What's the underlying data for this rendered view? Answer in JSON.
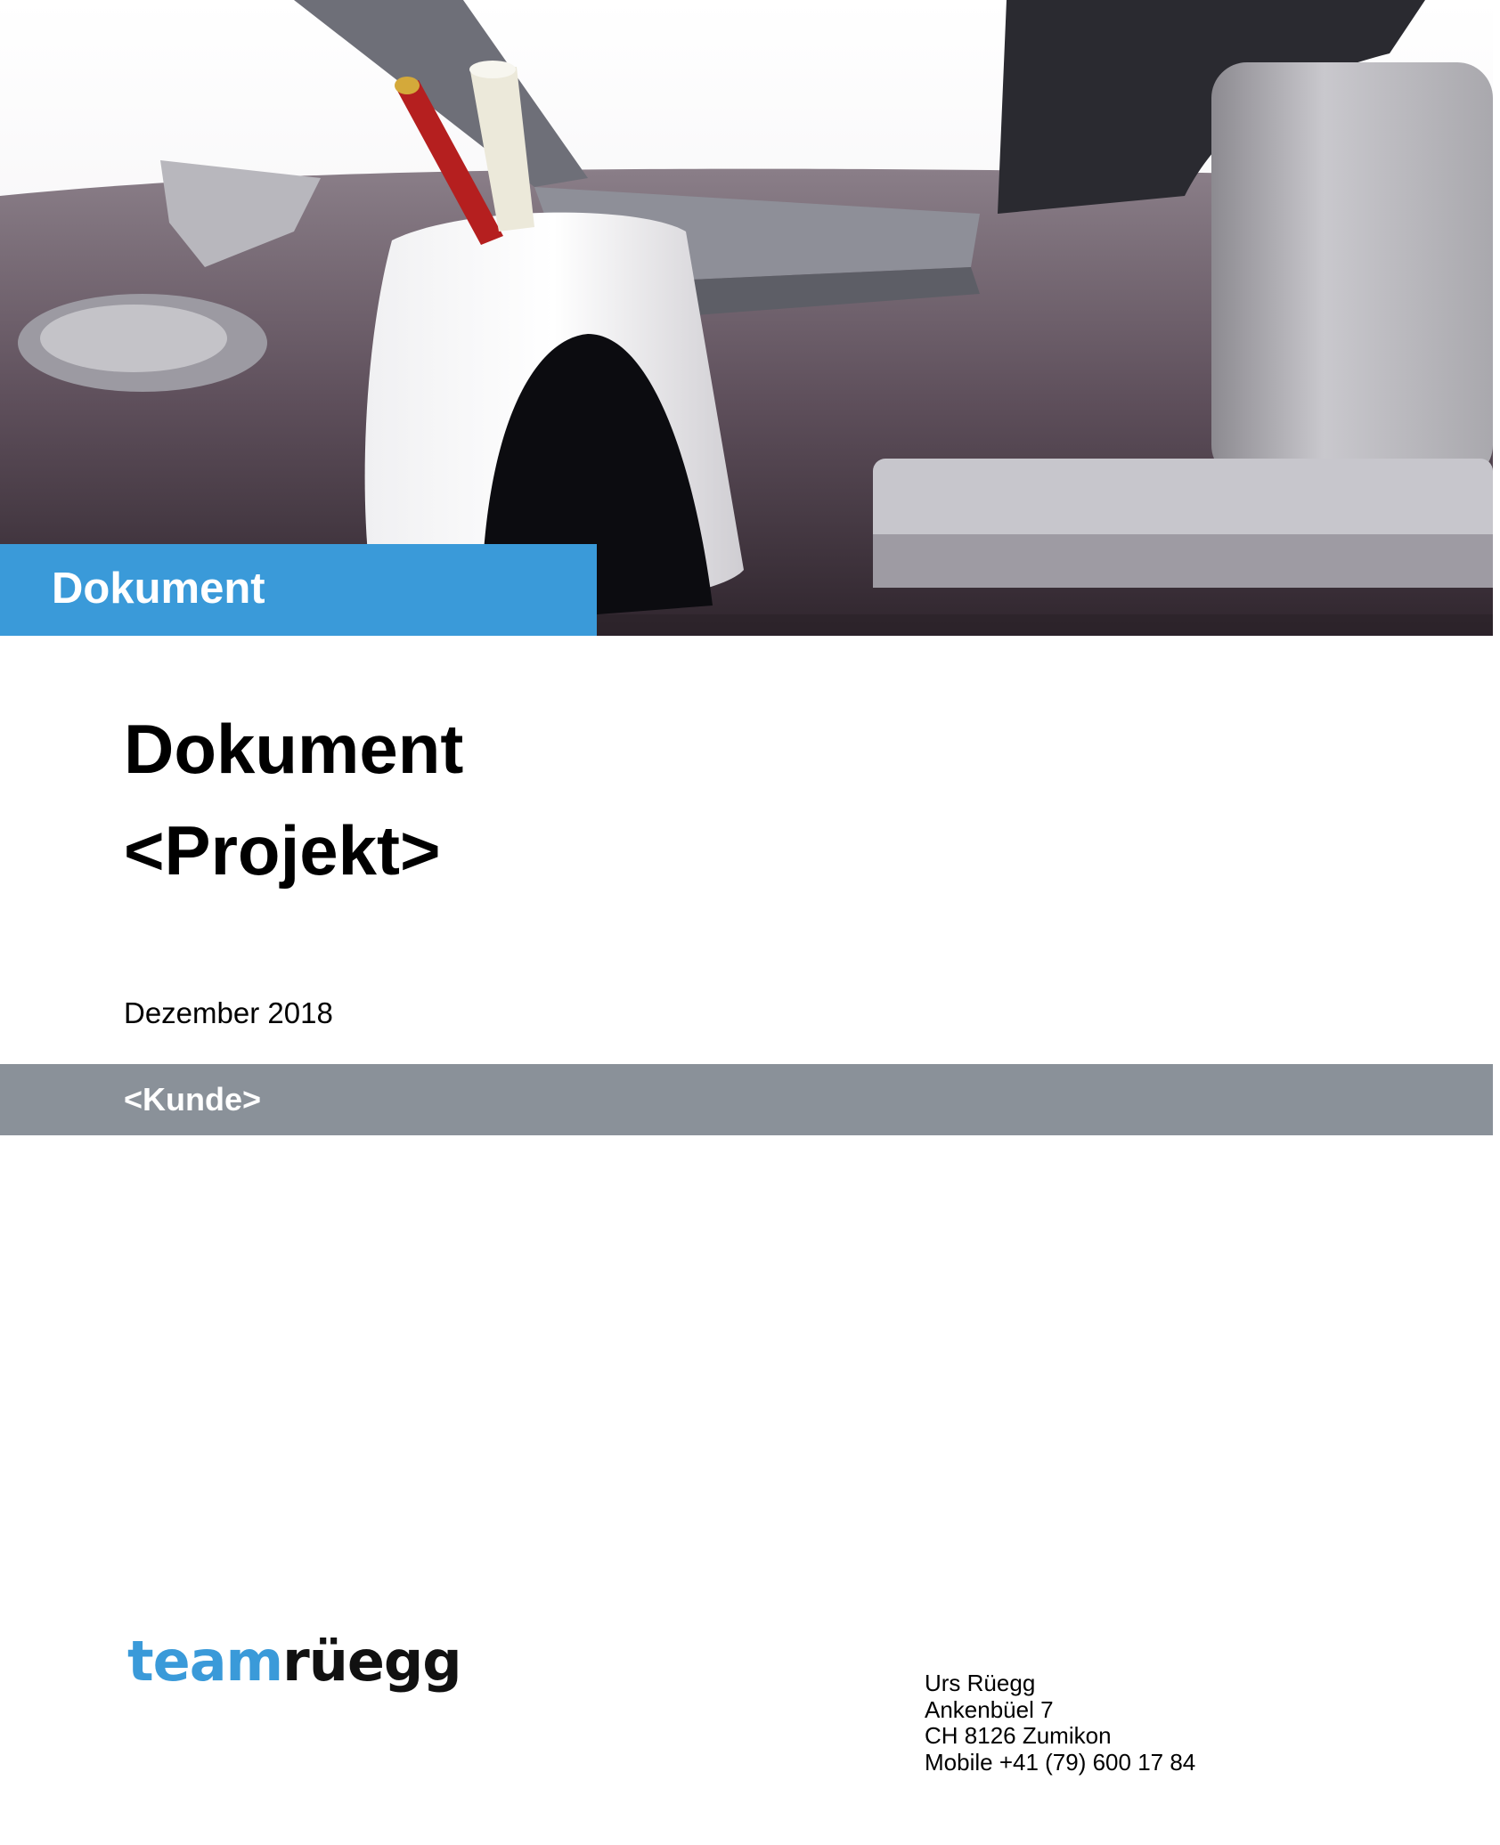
{
  "hero": {
    "label": "Dokument",
    "image": "desk-photo-pen-holder"
  },
  "title": {
    "line1": "Dokument",
    "line2": "<Projekt>"
  },
  "date": "Dezember 2018",
  "client": "<Kunde>",
  "logo": {
    "part1": "team",
    "part2": "rüegg"
  },
  "address": {
    "name": "Urs Rüegg",
    "street": "Ankenbüel 7",
    "city": "CH 8126 Zumikon",
    "phone": "Mobile +41 (79) 600 17 84"
  },
  "colors": {
    "accent": "#3a9ad9",
    "band": "#8a9199"
  }
}
